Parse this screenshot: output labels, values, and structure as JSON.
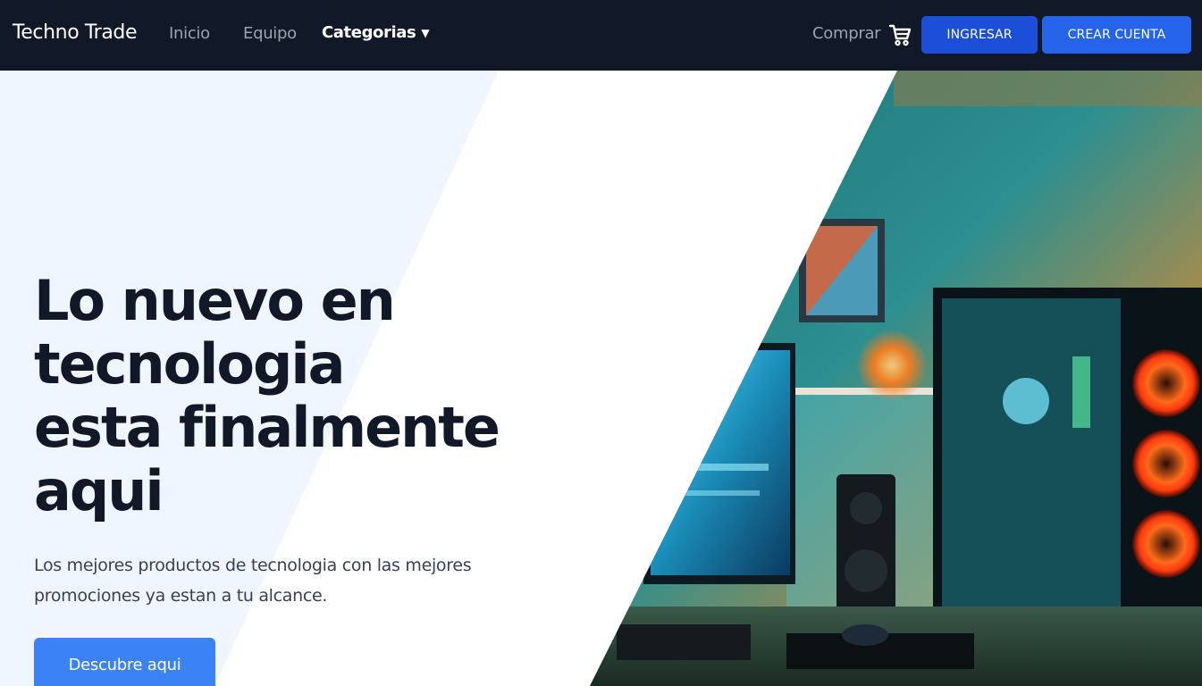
{
  "navbar": {
    "brand": "Techno Trade",
    "links": {
      "inicio": "Inicio",
      "equipo": "Equipo",
      "categorias": "Categorias",
      "categorias_caret": "▼"
    },
    "comprar": "Comprar",
    "cart_icon": "shopping-cart-icon",
    "ingresar": "INGRESAR",
    "crear_cuenta": "CREAR CUENTA"
  },
  "hero": {
    "headline": [
      "Lo nuevo en",
      "tecnologia",
      "esta finalmente",
      "aqui"
    ],
    "subtitle_line1": "Los mejores productos de tecnologia con las mejores",
    "subtitle_line2": "promociones ya estan a tu alcance.",
    "cta": "Descubre aqui",
    "image": "gaming-pc-setup-photo"
  },
  "colors": {
    "navbar_bg": "#111827",
    "primary_button": "#1d4ed8",
    "cta_button": "#3b82f6",
    "hero_tint": "#eff6ff",
    "headline_text": "#111827"
  }
}
